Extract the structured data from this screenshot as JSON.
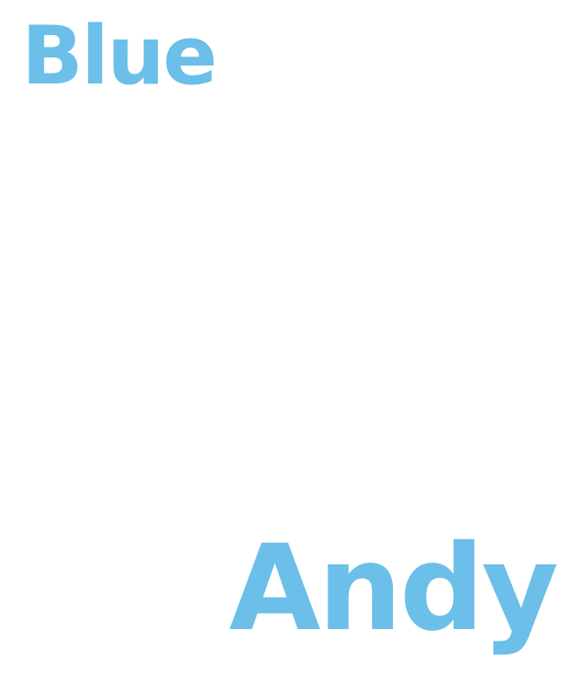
{
  "words": {
    "top": "Blue",
    "bottom": "Andy"
  },
  "colors": {
    "text": "#6BBFE8",
    "background": "#FFFFFF"
  }
}
